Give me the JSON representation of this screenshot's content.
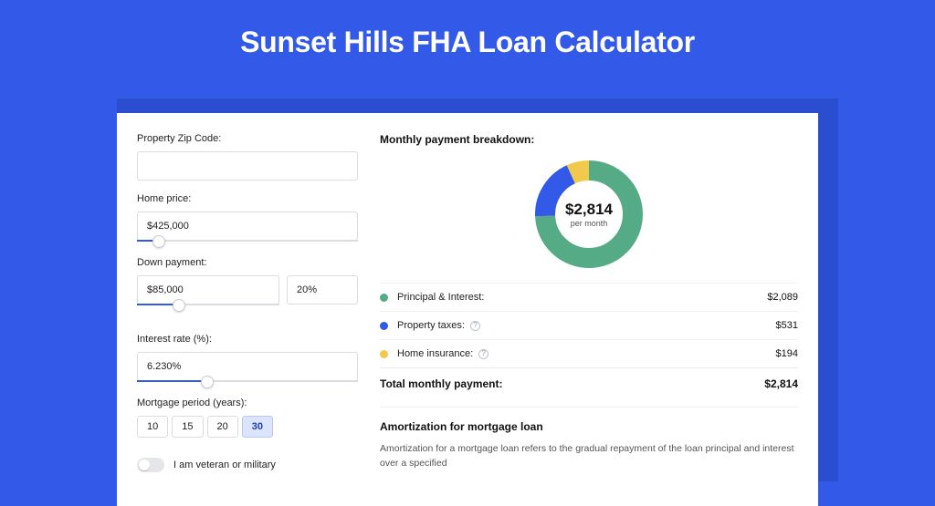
{
  "page_title": "Sunset Hills FHA Loan Calculator",
  "form": {
    "zip_label": "Property Zip Code:",
    "zip_value": "",
    "home_price_label": "Home price:",
    "home_price_value": "$425,000",
    "down_payment_label": "Down payment:",
    "down_payment_value": "$85,000",
    "down_payment_pct": "20%",
    "interest_label": "Interest rate (%):",
    "interest_value": "6.230%",
    "period_label": "Mortgage period (years):",
    "period_options": [
      "10",
      "15",
      "20",
      "30"
    ],
    "period_selected": "30",
    "veteran_label": "I am veteran or military",
    "veteran_on": false
  },
  "breakdown": {
    "title": "Monthly payment breakdown:",
    "center_amount": "$2,814",
    "center_sub": "per month",
    "rows": [
      {
        "label": "Principal & Interest:",
        "value": "$2,089",
        "color": "green",
        "info": false
      },
      {
        "label": "Property taxes:",
        "value": "$531",
        "color": "blue",
        "info": true
      },
      {
        "label": "Home insurance:",
        "value": "$194",
        "color": "yellow",
        "info": true
      }
    ],
    "total_label": "Total monthly payment:",
    "total_value": "$2,814"
  },
  "amort": {
    "title": "Amortization for mortgage loan",
    "text": "Amortization for a mortgage loan refers to the gradual repayment of the loan principal and interest over a specified"
  },
  "chart_data": {
    "type": "pie",
    "title": "Monthly payment breakdown",
    "series": [
      {
        "name": "Principal & Interest",
        "value": 2089,
        "color": "#54ab86"
      },
      {
        "name": "Property taxes",
        "value": 531,
        "color": "#3259e8"
      },
      {
        "name": "Home insurance",
        "value": 194,
        "color": "#f1c94d"
      }
    ],
    "total": 2814,
    "center_label": "$2,814 per month"
  }
}
